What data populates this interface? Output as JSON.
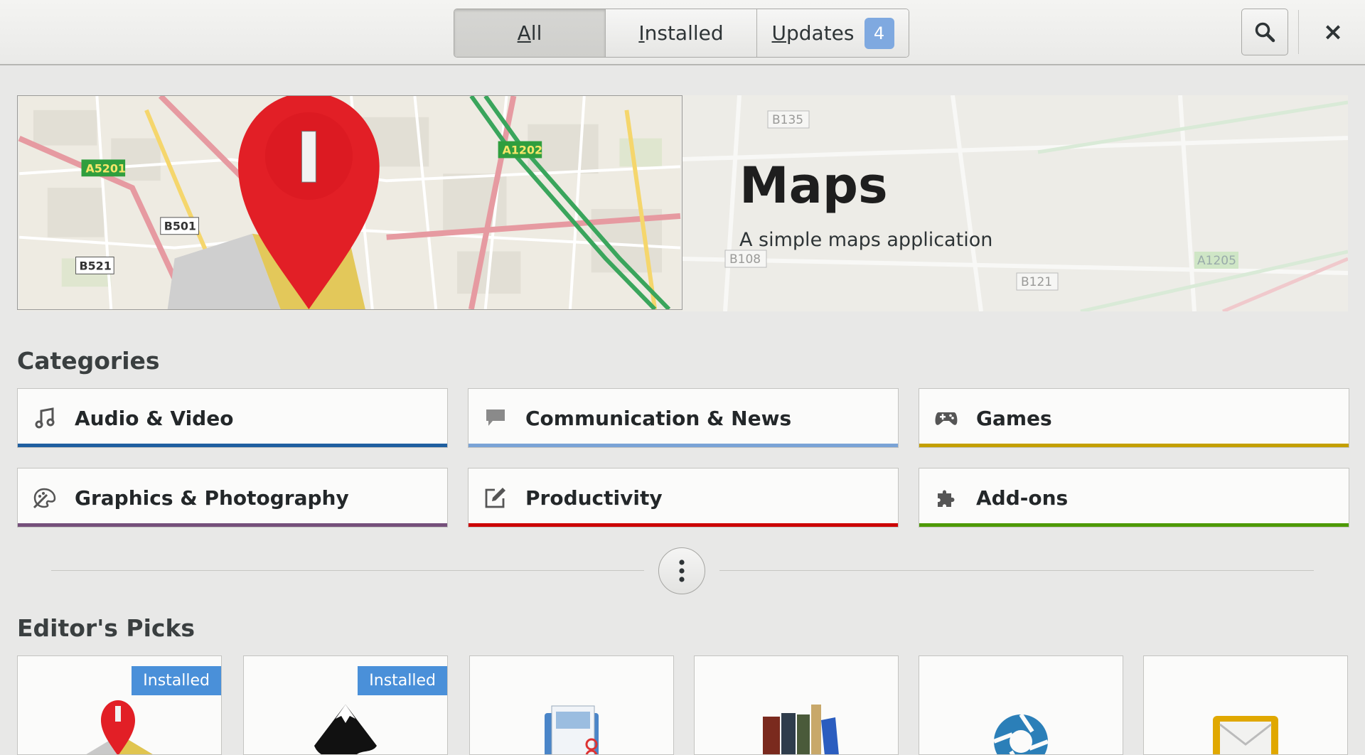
{
  "header": {
    "tabs": [
      {
        "pre": "",
        "key": "A",
        "post": "ll"
      },
      {
        "pre": "",
        "key": "I",
        "post": "nstalled"
      },
      {
        "pre": "",
        "key": "U",
        "post": "pdates"
      }
    ],
    "updates_count": "4",
    "close_label": "×"
  },
  "banner": {
    "title": "Maps",
    "subtitle": "A simple maps application"
  },
  "categories_title": "Categories",
  "categories": [
    {
      "label": "Audio & Video",
      "icon": "music-note-icon",
      "color": "#1f5fa0"
    },
    {
      "label": "Communication & News",
      "icon": "chat-bubble-icon",
      "color": "#7aa3d6"
    },
    {
      "label": "Games",
      "icon": "gamepad-icon",
      "color": "#c4a000"
    },
    {
      "label": "Graphics & Photography",
      "icon": "palette-icon",
      "color": "#75507b"
    },
    {
      "label": "Productivity",
      "icon": "edit-icon",
      "color": "#cc0000"
    },
    {
      "label": "Add-ons",
      "icon": "puzzle-icon",
      "color": "#4e9a06"
    }
  ],
  "editors_picks_title": "Editor's Picks",
  "picks": [
    {
      "badge": "Installed",
      "icon": "maps-app-icon"
    },
    {
      "badge": "Installed",
      "icon": "inkscape-app-icon"
    },
    {
      "badge": "",
      "icon": "document-scanner-icon"
    },
    {
      "badge": "",
      "icon": "calibre-books-icon"
    },
    {
      "badge": "",
      "icon": "shutter-app-icon"
    },
    {
      "badge": "",
      "icon": "mail-app-icon"
    }
  ]
}
